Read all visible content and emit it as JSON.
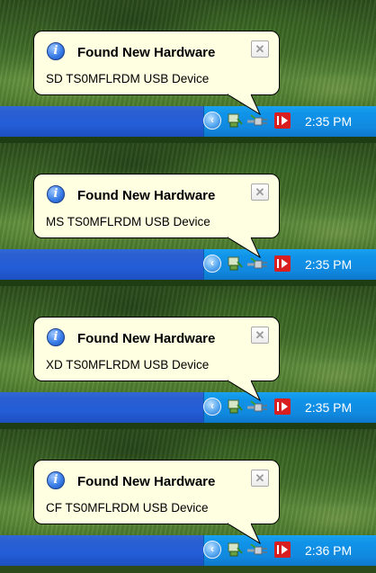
{
  "notifications": [
    {
      "title": "Found New Hardware",
      "message": "SD  TS0MFLRDM USB Device",
      "clock": "2:35 PM"
    },
    {
      "title": "Found New Hardware",
      "message": "MS  TS0MFLRDM USB Device",
      "clock": "2:35 PM"
    },
    {
      "title": "Found New Hardware",
      "message": "XD  TS0MFLRDM USB Device",
      "clock": "2:35 PM"
    },
    {
      "title": "Found New Hardware",
      "message": "CF  TS0MFLRDM USB Device",
      "clock": "2:36 PM"
    }
  ],
  "icons": {
    "balloon": "info-icon",
    "close": "close-icon",
    "expand": "chevron-left-icon",
    "tray": [
      "hardware-icon",
      "usb-plug-icon",
      "media-icon"
    ]
  },
  "colors": {
    "balloon_bg": "#ffffe1",
    "taskbar": "#245dd8",
    "tray": "#0f93e8"
  }
}
